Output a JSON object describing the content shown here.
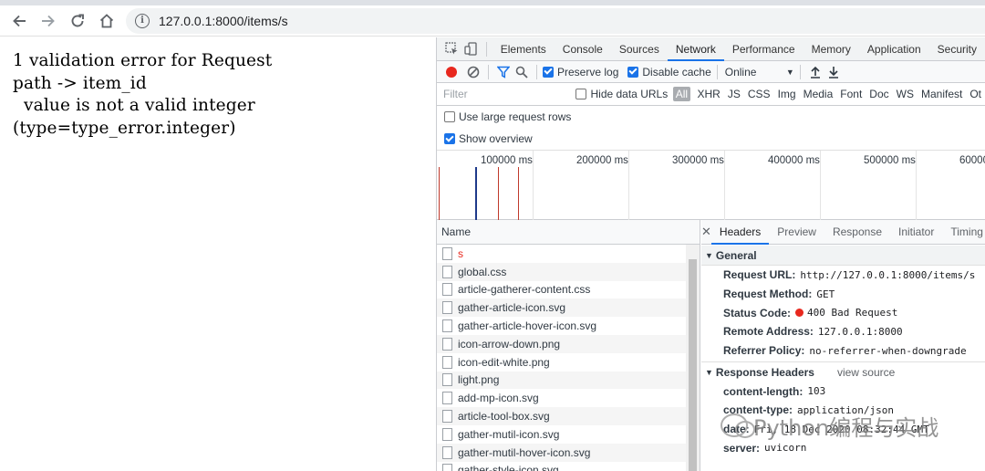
{
  "browser": {
    "url": "127.0.0.1:8000/items/s"
  },
  "page": {
    "error_text": "1 validation error for Request\npath -> item_id\n  value is not a valid integer\n(type=type_error.integer)"
  },
  "devtools": {
    "tabs": [
      {
        "label": "Elements"
      },
      {
        "label": "Console"
      },
      {
        "label": "Sources"
      },
      {
        "label": "Network"
      },
      {
        "label": "Performance"
      },
      {
        "label": "Memory"
      },
      {
        "label": "Application"
      },
      {
        "label": "Security"
      }
    ],
    "active_tab": "Network",
    "toolbar": {
      "preserve_log": "Preserve log",
      "disable_cache": "Disable cache",
      "throttling": "Online",
      "preserve_log_checked": true,
      "disable_cache_checked": true
    },
    "filter": {
      "placeholder": "Filter",
      "hide_data_urls": "Hide data URLs",
      "types": [
        "All",
        "XHR",
        "JS",
        "CSS",
        "Img",
        "Media",
        "Font",
        "Doc",
        "WS",
        "Manifest",
        "Ot"
      ]
    },
    "options": {
      "large_rows": "Use large request rows",
      "large_rows_checked": false,
      "show_overview": "Show overview",
      "show_overview_checked": true
    },
    "overview": {
      "ticks": [
        "100000 ms",
        "200000 ms",
        "300000 ms",
        "400000 ms",
        "500000 ms",
        "60000"
      ]
    },
    "requests": {
      "header": "Name",
      "items": [
        {
          "name": "s",
          "error": true
        },
        {
          "name": "global.css"
        },
        {
          "name": "article-gatherer-content.css"
        },
        {
          "name": "gather-article-icon.svg"
        },
        {
          "name": "gather-article-hover-icon.svg"
        },
        {
          "name": "icon-arrow-down.png"
        },
        {
          "name": "icon-edit-white.png"
        },
        {
          "name": "light.png"
        },
        {
          "name": "add-mp-icon.svg"
        },
        {
          "name": "article-tool-box.svg"
        },
        {
          "name": "gather-mutil-icon.svg"
        },
        {
          "name": "gather-mutil-hover-icon.svg"
        },
        {
          "name": "gather-style-icon.svg"
        }
      ]
    },
    "detail": {
      "tabs": [
        "Headers",
        "Preview",
        "Response",
        "Initiator",
        "Timing"
      ],
      "general_title": "General",
      "general": [
        {
          "key": "Request URL:",
          "value": "http://127.0.0.1:8000/items/s"
        },
        {
          "key": "Request Method:",
          "value": "GET"
        },
        {
          "key": "Status Code:",
          "value": "400 Bad Request"
        },
        {
          "key": "Remote Address:",
          "value": "127.0.0.1:8000"
        },
        {
          "key": "Referrer Policy:",
          "value": "no-referrer-when-downgrade"
        }
      ],
      "response_title": "Response Headers",
      "view_source": "view source",
      "response": [
        {
          "key": "content-length:",
          "value": "103"
        },
        {
          "key": "content-type:",
          "value": "application/json"
        },
        {
          "key": "date:",
          "value": "Fri, 18 Dec 2020 08:32:44 GMT"
        },
        {
          "key": "server:",
          "value": "uvicorn"
        }
      ]
    }
  },
  "watermark": {
    "text": "Python编程与实战"
  },
  "colors": {
    "accent": "#1a73e8",
    "error": "#e8281e"
  }
}
